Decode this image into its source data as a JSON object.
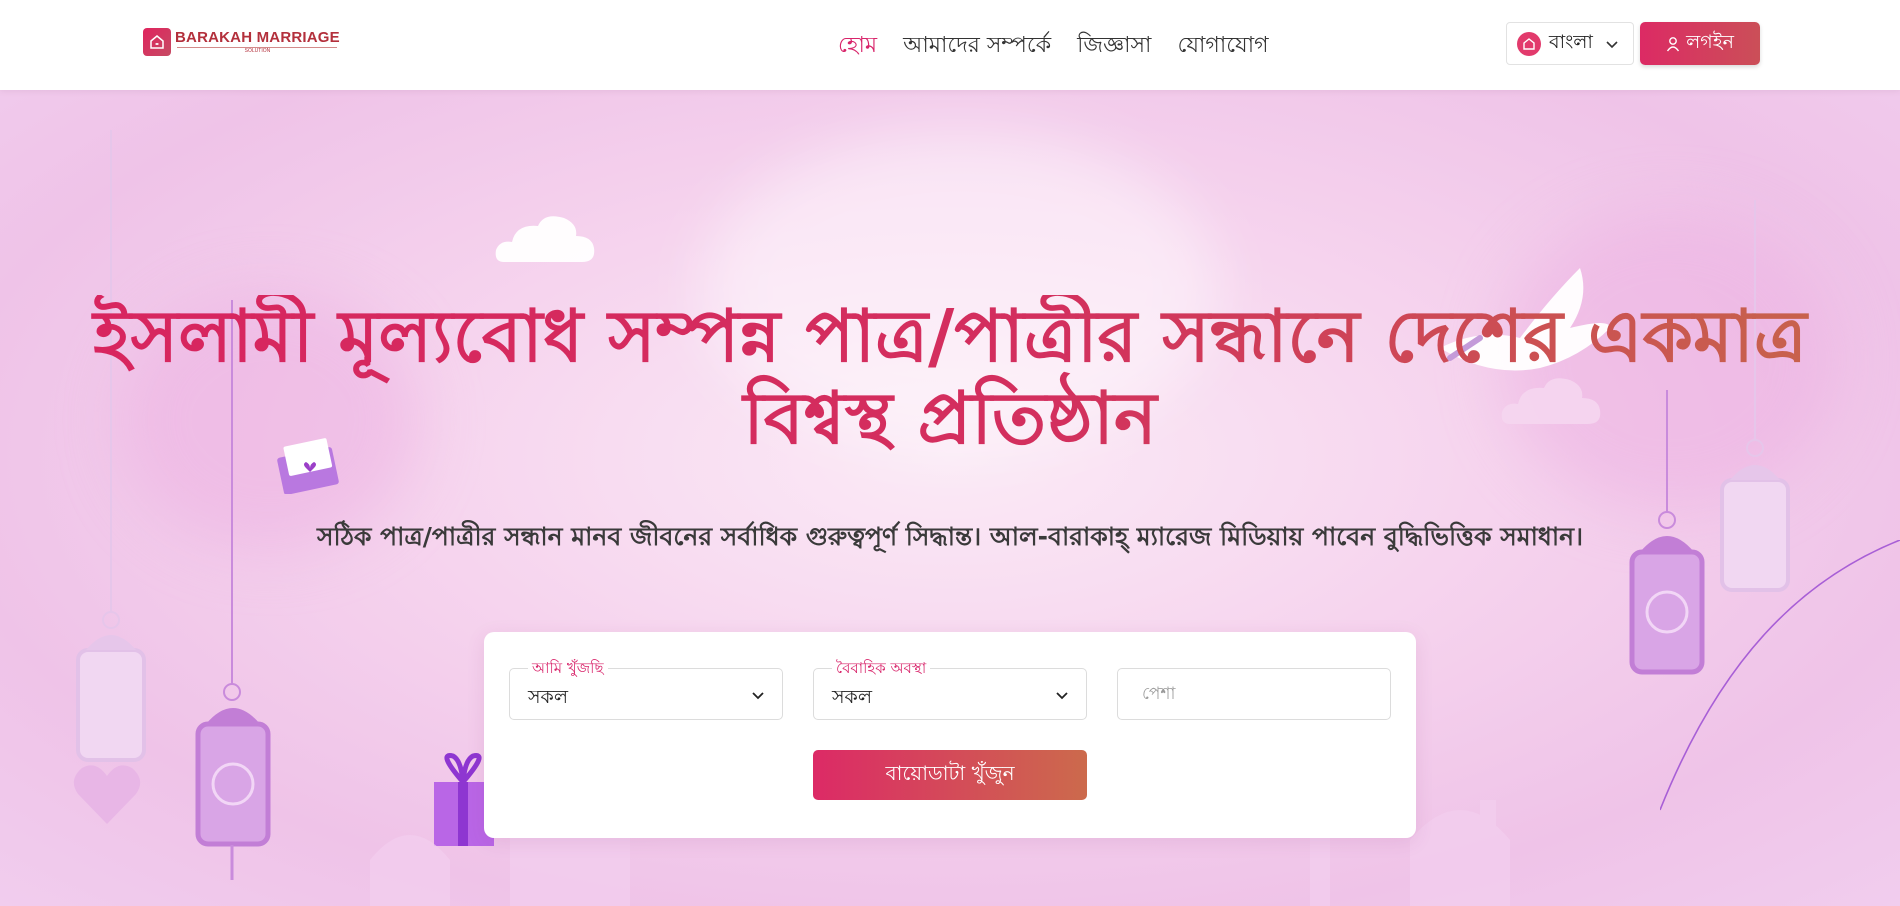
{
  "header": {
    "logo": {
      "name": "BARAKAH MARRIAGE",
      "sub": "SOLUTION"
    },
    "nav": [
      {
        "label": "হোম",
        "active": true
      },
      {
        "label": "আমাদের সম্পর্কে",
        "active": false
      },
      {
        "label": "জিজ্ঞাসা",
        "active": false
      },
      {
        "label": "যোগাযোগ",
        "active": false
      }
    ],
    "language": {
      "label": "বাংলা",
      "icon": "language-globe-icon"
    },
    "login": {
      "label": "লগইন",
      "icon": "user-icon"
    }
  },
  "hero": {
    "title_line1": "ইসলামী মূল্যবোধ সম্পন্ন পাত্র/পাত্রীর সন্ধানে দেশের একমাত্র",
    "title_line2": "বিশ্বস্থ প্রতিষ্ঠান",
    "subtitle": "সঠিক পাত্র/পাত্রীর সন্ধান মানব জীবনের সর্বাধিক গুরুত্বপূর্ণ সিদ্ধান্ত। আল-বারাকাহ্ ম্যারেজ মিডিয়ায় পাবেন বুদ্ধিভিত্তিক সমাধান।"
  },
  "search": {
    "looking_for": {
      "label": "আমি খুঁজছি",
      "value": "সকল"
    },
    "marital_status": {
      "label": "বৈবাহিক অবস্থা",
      "value": "সকল"
    },
    "profession": {
      "placeholder": "পেশা"
    },
    "button": "বায়োডাটা খুঁজুন"
  },
  "colors": {
    "accent": "#d8246a",
    "accent_end": "#cc6a4c",
    "hero_bg": "#f6d4ee"
  }
}
